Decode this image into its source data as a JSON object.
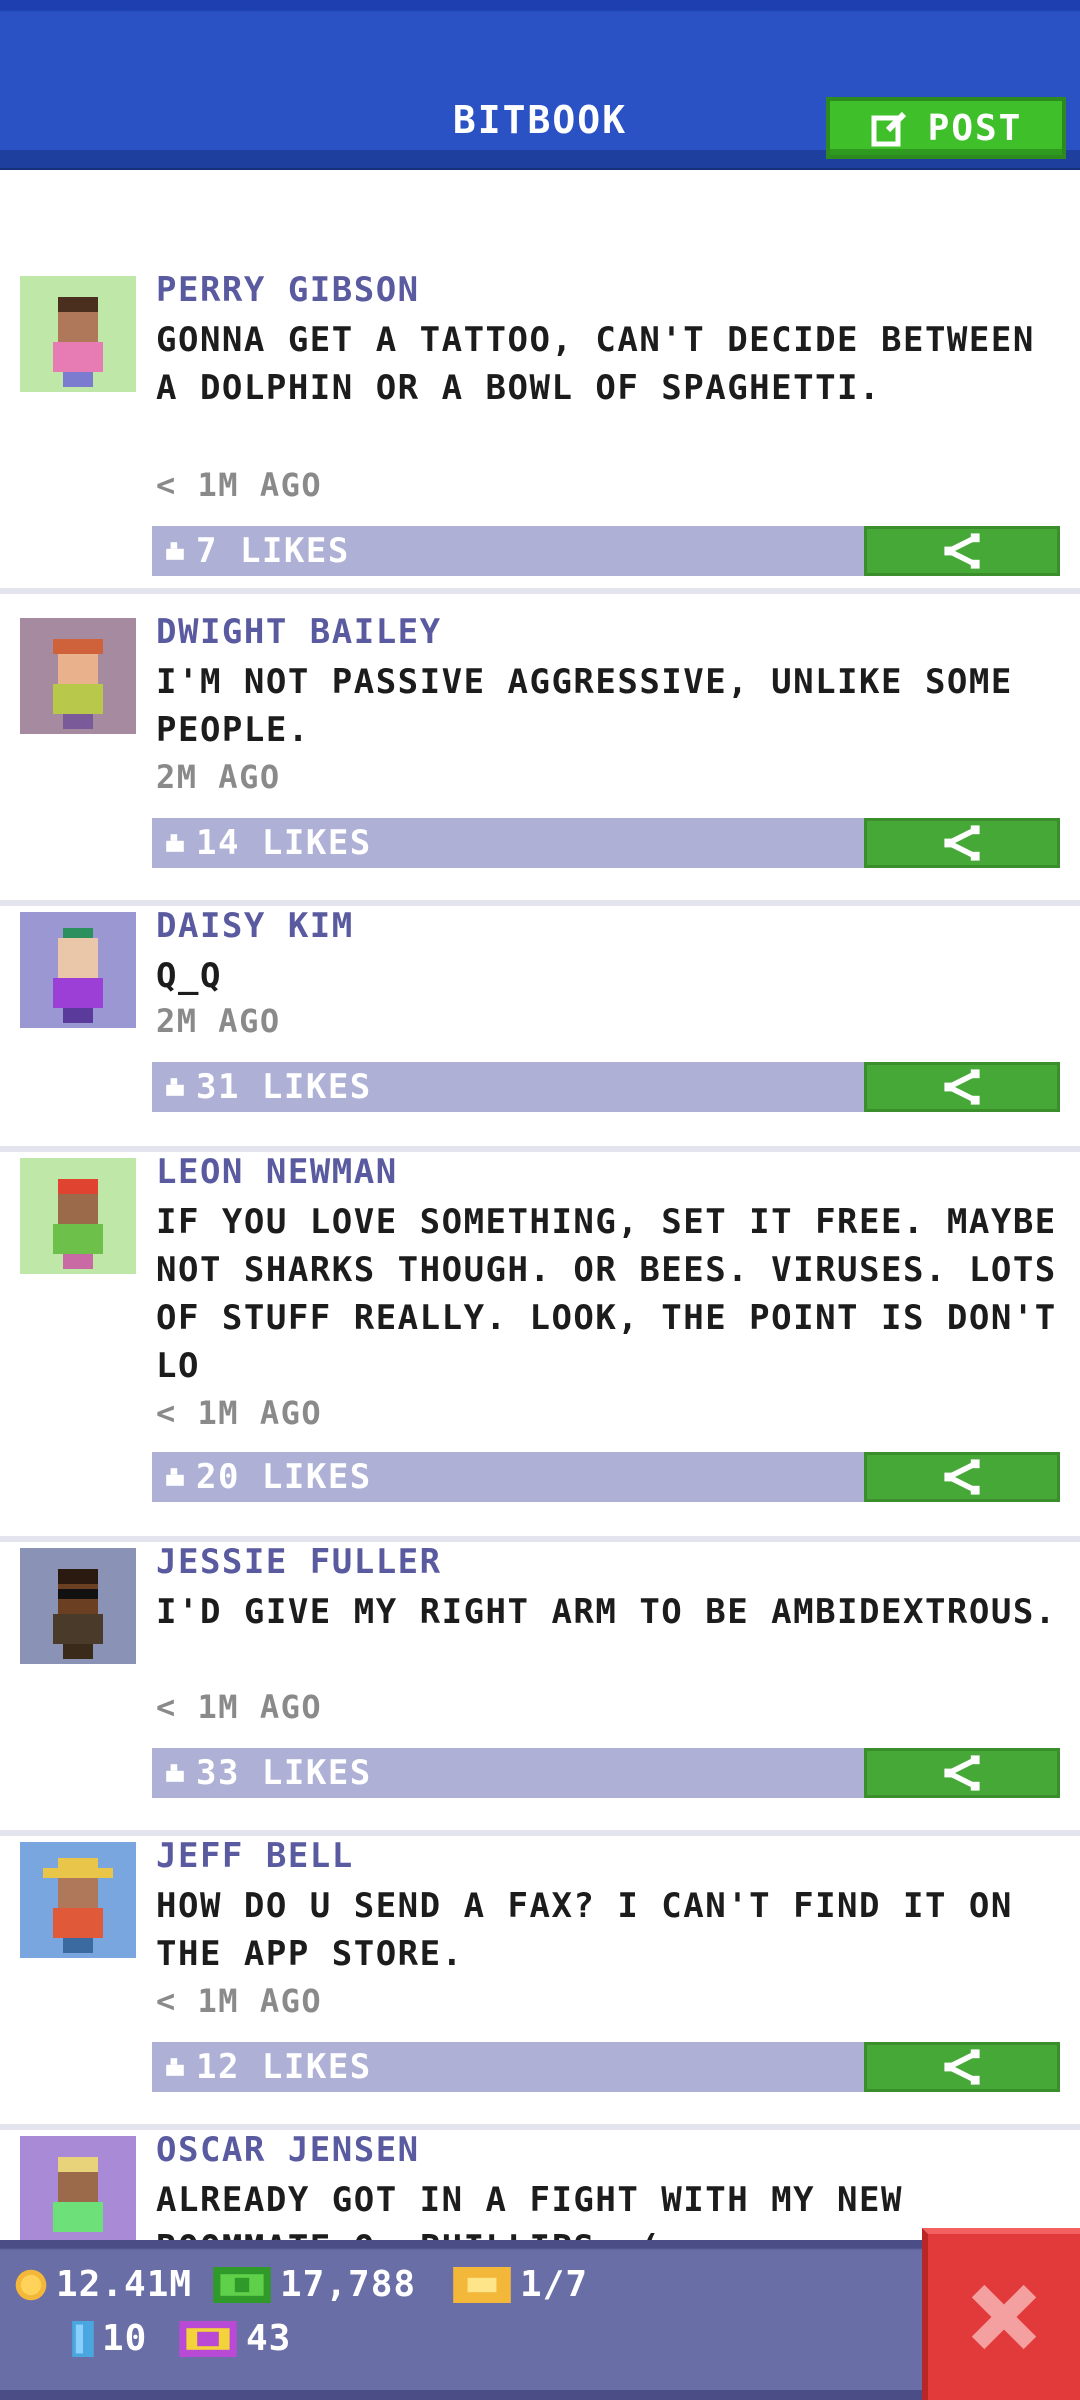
{
  "header": {
    "title": "BITBOOK",
    "post_label": "POST"
  },
  "posts": [
    {
      "name": "PERRY GIBSON",
      "text": "GONNA GET A TATTOO, CAN'T DECIDE BETWEEN A DOLPHIN OR A BOWL OF SPAGHETTI.",
      "time": "< 1M AGO",
      "likes": "7 LIKES",
      "avatar_bg": "#bfe7a8"
    },
    {
      "name": "DWIGHT BAILEY",
      "text": "I'M NOT PASSIVE AGGRESSIVE, UNLIKE SOME PEOPLE.",
      "time": "2M AGO",
      "likes": "14 LIKES",
      "avatar_bg": "#a58aa0"
    },
    {
      "name": "DAISY KIM",
      "text": "Q_Q",
      "time": "2M AGO",
      "likes": "31 LIKES",
      "avatar_bg": "#9a97d3"
    },
    {
      "name": "LEON NEWMAN",
      "text": "IF YOU LOVE SOMETHING, SET IT FREE. MAYBE NOT SHARKS THOUGH. OR BEES. VIRUSES. LOTS OF STUFF REALLY. LOOK, THE POINT IS DON'T LO",
      "time": "< 1M AGO",
      "likes": "20 LIKES",
      "avatar_bg": "#bfe7a8"
    },
    {
      "name": "JESSIE FULLER",
      "text": "I'D GIVE MY RIGHT ARM TO BE AMBIDEXTROUS.",
      "time": "< 1M AGO",
      "likes": "33 LIKES",
      "avatar_bg": "#8a93b6"
    },
    {
      "name": "JEFF BELL",
      "text": "HOW DO U SEND A FAX? I CAN'T FIND IT ON THE APP STORE.",
      "time": "< 1M AGO",
      "likes": "12 LIKES",
      "avatar_bg": "#7aa6df"
    },
    {
      "name": "OSCAR JENSEN",
      "text": "ALREADY GOT IN A FIGHT WITH MY NEW ROOMMATE O. PHILLIPS :(",
      "time": "",
      "likes": "",
      "avatar_bg": "#a88ad6"
    }
  ],
  "stats": {
    "coins": "12.41M",
    "bux": "17,788",
    "tickets": "1/7",
    "items": "10",
    "vip": "43"
  },
  "colors": {
    "header_blue": "#2a52c4",
    "name_color": "#5a5aa0",
    "likes_bar": "#aeb0d6",
    "share_green": "#46a837",
    "close_red": "#e23a3a"
  }
}
